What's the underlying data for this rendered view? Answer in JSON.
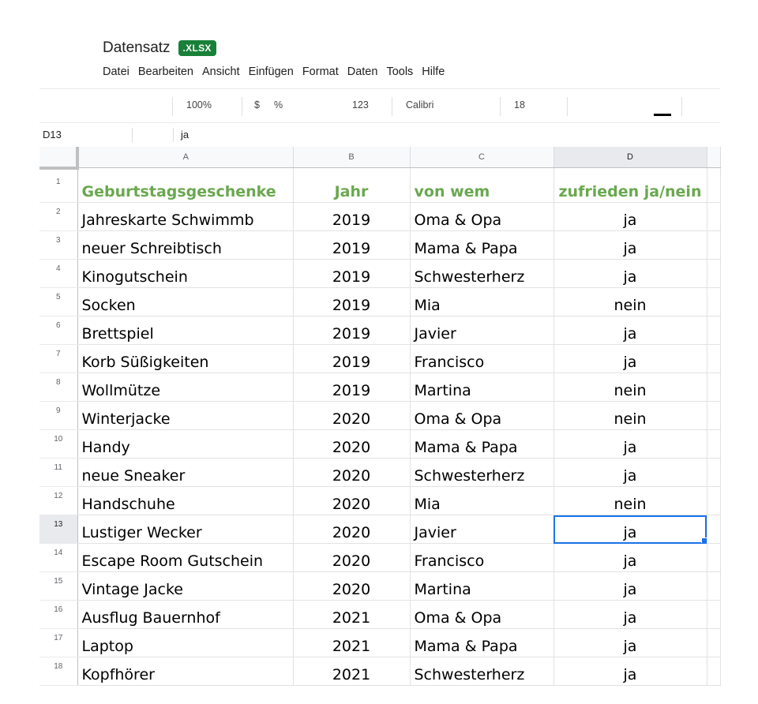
{
  "header": {
    "title": "Datensatz",
    "badge": ".XLSX"
  },
  "menu": [
    "Datei",
    "Bearbeiten",
    "Ansicht",
    "Einfügen",
    "Format",
    "Daten",
    "Tools",
    "Hilfe"
  ],
  "toolbar": {
    "zoom": "100%",
    "currency": "$",
    "percent": "%",
    "number_format": "123",
    "font": "Calibri",
    "font_size": "18"
  },
  "formula_bar": {
    "cell_ref": "D13",
    "value": "ja"
  },
  "columns": [
    "A",
    "B",
    "C",
    "D"
  ],
  "active_column": "D",
  "active_row": 13,
  "header_row": {
    "row": "1",
    "a": "Geburtstagsgeschenke",
    "b": "Jahr",
    "c": "von wem",
    "d": "zufrieden ja/nein"
  },
  "rows": [
    {
      "row": "2",
      "a": "Jahreskarte Schwimmb",
      "b": "2019",
      "c": "Oma & Opa",
      "d": "ja"
    },
    {
      "row": "3",
      "a": "neuer Schreibtisch",
      "b": "2019",
      "c": "Mama & Papa",
      "d": "ja"
    },
    {
      "row": "4",
      "a": "Kinogutschein",
      "b": "2019",
      "c": "Schwesterherz",
      "d": "ja"
    },
    {
      "row": "5",
      "a": "Socken",
      "b": "2019",
      "c": "Mia",
      "d": "nein"
    },
    {
      "row": "6",
      "a": "Brettspiel",
      "b": "2019",
      "c": "Javier",
      "d": "ja"
    },
    {
      "row": "7",
      "a": "Korb Süßigkeiten",
      "b": "2019",
      "c": "Francisco",
      "d": "ja"
    },
    {
      "row": "8",
      "a": "Wollmütze",
      "b": "2019",
      "c": "Martina",
      "d": "nein"
    },
    {
      "row": "9",
      "a": "Winterjacke",
      "b": "2020",
      "c": "Oma & Opa",
      "d": "nein"
    },
    {
      "row": "10",
      "a": "Handy",
      "b": "2020",
      "c": "Mama & Papa",
      "d": "ja"
    },
    {
      "row": "11",
      "a": "neue Sneaker",
      "b": "2020",
      "c": "Schwesterherz",
      "d": "ja"
    },
    {
      "row": "12",
      "a": "Handschuhe",
      "b": "2020",
      "c": "Mia",
      "d": "nein"
    },
    {
      "row": "13",
      "a": "Lustiger Wecker",
      "b": "2020",
      "c": "Javier",
      "d": "ja"
    },
    {
      "row": "14",
      "a": "Escape Room Gutschein",
      "b": "2020",
      "c": "Francisco",
      "d": "ja"
    },
    {
      "row": "15",
      "a": "Vintage Jacke",
      "b": "2020",
      "c": "Martina",
      "d": "ja"
    },
    {
      "row": "16",
      "a": "Ausflug Bauernhof",
      "b": "2021",
      "c": "Oma & Opa",
      "d": "ja"
    },
    {
      "row": "17",
      "a": "Laptop",
      "b": "2021",
      "c": "Mama & Papa",
      "d": "ja"
    },
    {
      "row": "18",
      "a": "Kopfhörer",
      "b": "2021",
      "c": "Schwesterherz",
      "d": "ja"
    }
  ]
}
